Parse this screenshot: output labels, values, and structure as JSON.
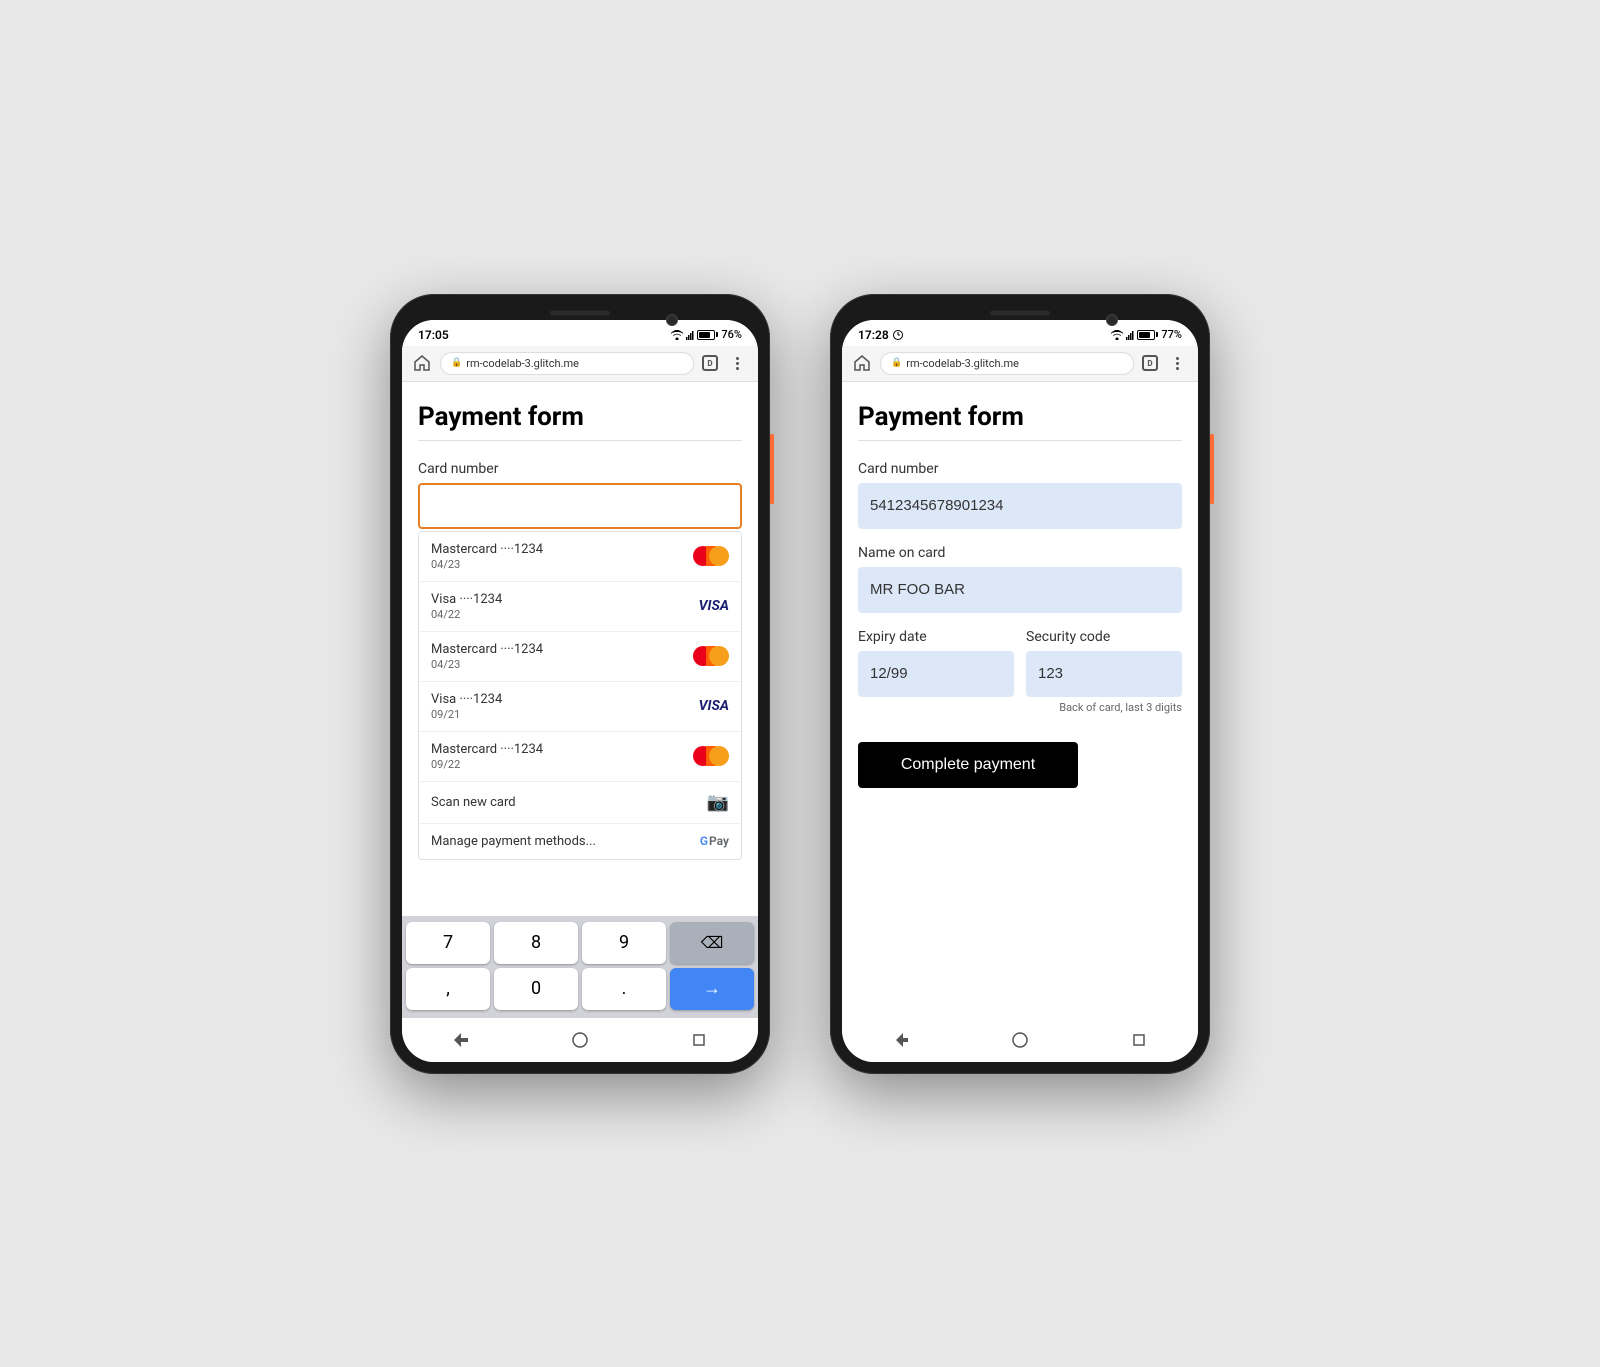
{
  "phone1": {
    "status_bar": {
      "time": "17:05",
      "battery_percent": "76%",
      "url": "rm-codelab-3.glitch.me"
    },
    "page": {
      "title": "Payment form"
    },
    "form": {
      "card_number_label": "Card number",
      "card_number_placeholder": ""
    },
    "autocomplete": {
      "items": [
        {
          "type": "Mastercard",
          "dots": "····1234",
          "expiry": "04/23",
          "brand": "mastercard"
        },
        {
          "type": "Visa",
          "dots": "····1234",
          "expiry": "04/22",
          "brand": "visa"
        },
        {
          "type": "Mastercard",
          "dots": "····1234",
          "expiry": "04/23",
          "brand": "mastercard"
        },
        {
          "type": "Visa",
          "dots": "····1234",
          "expiry": "09/21",
          "brand": "visa"
        },
        {
          "type": "Mastercard",
          "dots": "····1234",
          "expiry": "09/22",
          "brand": "mastercard"
        }
      ],
      "scan_label": "Scan new card",
      "manage_label": "Manage payment methods..."
    },
    "keyboard": {
      "rows": [
        [
          "7",
          "8",
          "9",
          "⌫"
        ],
        [
          ",",
          "0",
          ".",
          "→"
        ]
      ]
    },
    "nav": {
      "back": "▼",
      "home": "●",
      "recents": "■"
    }
  },
  "phone2": {
    "status_bar": {
      "time": "17:28",
      "battery_percent": "77%",
      "url": "rm-codelab-3.glitch.me"
    },
    "page": {
      "title": "Payment form"
    },
    "form": {
      "card_number_label": "Card number",
      "card_number_value": "5412345678901234",
      "name_label": "Name on card",
      "name_value": "MR FOO BAR",
      "expiry_label": "Expiry date",
      "expiry_value": "12/99",
      "security_label": "Security code",
      "security_value": "123",
      "security_hint": "Back of card, last 3 digits",
      "submit_label": "Complete payment"
    },
    "nav": {
      "back": "◀",
      "home": "●",
      "recents": "■"
    }
  }
}
